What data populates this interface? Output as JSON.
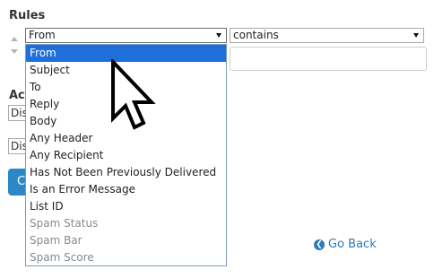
{
  "rules": {
    "heading": "Rules",
    "field_select": {
      "value": "From"
    },
    "operator_select": {
      "value": "contains"
    },
    "value_input": {
      "value": ""
    }
  },
  "dropdown": {
    "options": [
      {
        "label": "From",
        "state": "selected"
      },
      {
        "label": "Subject",
        "state": "normal"
      },
      {
        "label": "To",
        "state": "normal"
      },
      {
        "label": "Reply",
        "state": "normal"
      },
      {
        "label": "Body",
        "state": "normal"
      },
      {
        "label": "Any Header",
        "state": "normal"
      },
      {
        "label": "Any Recipient",
        "state": "normal"
      },
      {
        "label": "Has Not Been Previously Delivered",
        "state": "normal"
      },
      {
        "label": "Is an Error Message",
        "state": "normal"
      },
      {
        "label": "List ID",
        "state": "normal"
      },
      {
        "label": "Spam Status",
        "state": "disabled"
      },
      {
        "label": "Spam Bar",
        "state": "disabled"
      },
      {
        "label": "Spam Score",
        "state": "disabled"
      }
    ]
  },
  "actions": {
    "heading": "Act",
    "action_1": "Dis",
    "action_2": "Dis",
    "create_button": "C"
  },
  "go_back": {
    "label": "Go Back",
    "icon": "arrow-left-circle-icon"
  },
  "colors": {
    "selected_bg": "#1e6fd9",
    "link": "#2d7ab9",
    "button": "#2a88c6"
  }
}
